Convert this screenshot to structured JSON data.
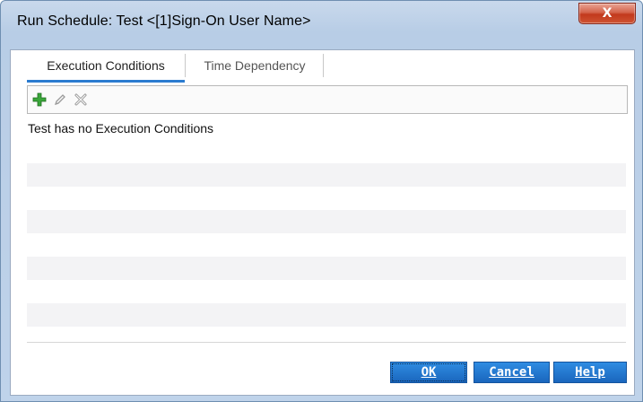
{
  "window": {
    "title": "Run Schedule: Test <[1]Sign-On User Name>",
    "close_label": "X"
  },
  "tabs": [
    {
      "label": "Execution Conditions",
      "active": true
    },
    {
      "label": "Time Dependency",
      "active": false
    }
  ],
  "toolbar": {
    "icons": [
      "add-icon",
      "edit-icon",
      "delete-icon"
    ]
  },
  "content": {
    "empty_message": "Test has no Execution Conditions"
  },
  "buttons": {
    "ok": "OK",
    "cancel": "Cancel",
    "help": "Help"
  },
  "colors": {
    "accent": "#2b7bd0",
    "button": "#1f74cf",
    "add_icon": "#3aa53a"
  }
}
